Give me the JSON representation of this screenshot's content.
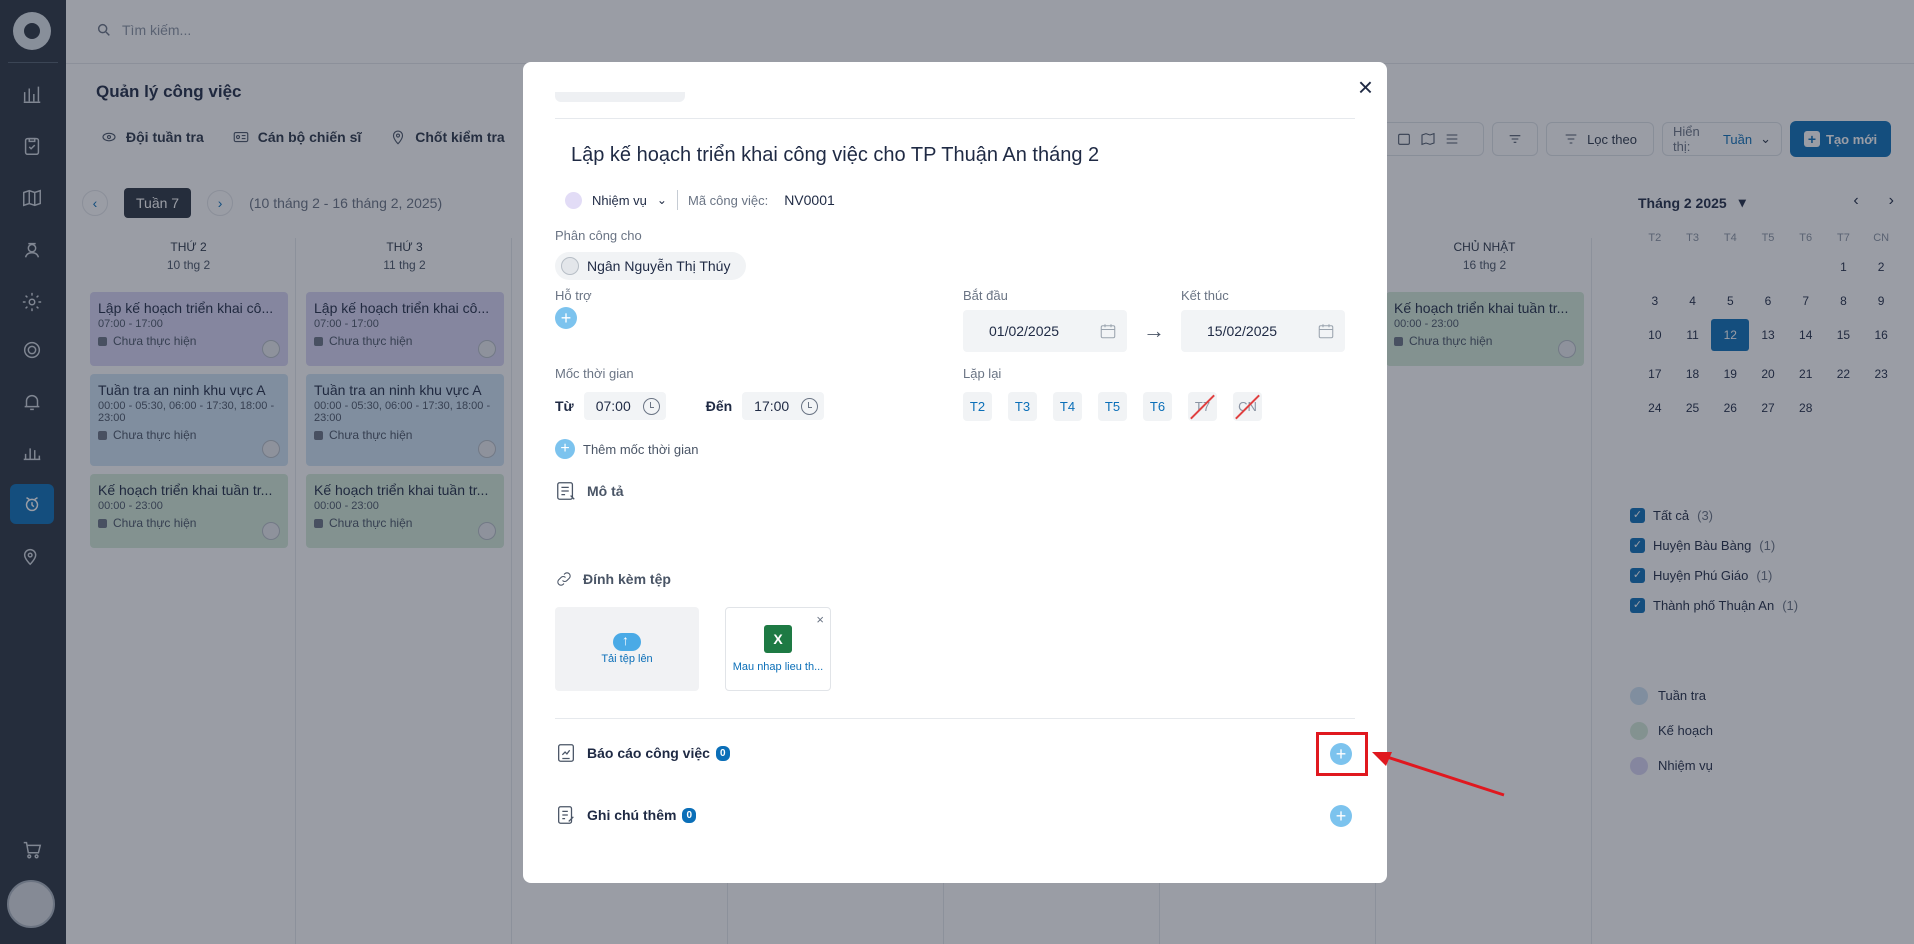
{
  "search": {
    "placeholder": "Tìm kiếm..."
  },
  "page": {
    "title": "Quản lý công việc"
  },
  "tabs": [
    {
      "label": "Đội tuần tra",
      "icon": "patrol-icon"
    },
    {
      "label": "Cán bộ chiến sĩ",
      "icon": "id-card-icon"
    },
    {
      "label": "Chốt kiểm tra",
      "icon": "location-pin-icon"
    }
  ],
  "toolbar": {
    "filter_label": "Lọc theo",
    "display_label": "Hiển thị:",
    "display_value": "Tuần",
    "new_label": "Tạo mới"
  },
  "week": {
    "label": "Tuần 7",
    "range": "(10 tháng 2 - 16 tháng 2, 2025)"
  },
  "columns": [
    {
      "day": "THỨ 2",
      "date": "10 thg 2"
    },
    {
      "day": "THỨ 3",
      "date": "11 thg 2"
    },
    {
      "day": "CHỦ NHẬT",
      "date": "16 thg 2"
    }
  ],
  "cards": {
    "c1": {
      "title": "Lập kế hoạch triển khai cô...",
      "time": "07:00 - 17:00",
      "status": "Chưa thực hiện"
    },
    "c2": {
      "title": "Tuần tra an ninh khu vực A",
      "time": "00:00 - 05:30, 06:00 - 17:30, 18:00 - 23:00",
      "status": "Chưa thực hiện"
    },
    "c3": {
      "title": "Kế hoạch triển khai tuần tr...",
      "time": "00:00 - 23:00",
      "status": "Chưa thực hiện"
    },
    "c4": {
      "title": "Lập kế hoạch triển khai cô...",
      "time": "07:00 - 17:00",
      "status": "Chưa thực hiện"
    },
    "c5": {
      "title": "Tuần tra an ninh khu vực A",
      "time": "00:00 - 05:30, 06:00 - 17:30, 18:00 - 23:00",
      "status": "Chưa thực hiện"
    },
    "c6": {
      "title": "Kế hoạch triển khai tuần tr...",
      "time": "00:00 - 23:00",
      "status": "Chưa thực hiện"
    },
    "c7": {
      "title": "Kế hoạch triển khai tuần tr...",
      "time": "00:00 - 23:00",
      "status": "Chưa thực hiện"
    }
  },
  "minical": {
    "title": "Tháng 2 2025",
    "dow": [
      "T2",
      "T3",
      "T4",
      "T5",
      "T6",
      "T7",
      "CN"
    ],
    "days": [
      "",
      "",
      "",
      "",
      "",
      "1",
      "2",
      "3",
      "4",
      "5",
      "6",
      "7",
      "8",
      "9",
      "10",
      "11",
      "12",
      "13",
      "14",
      "15",
      "16",
      "17",
      "18",
      "19",
      "20",
      "21",
      "22",
      "23",
      "24",
      "25",
      "26",
      "27",
      "28",
      "",
      ""
    ],
    "today": "12"
  },
  "filters": [
    {
      "label": "Tất cả",
      "count": "(3)"
    },
    {
      "label": "Huyện Bàu Bàng",
      "count": "(1)"
    },
    {
      "label": "Huyện Phú Giáo",
      "count": "(1)"
    },
    {
      "label": "Thành phố Thuận An",
      "count": "(1)"
    }
  ],
  "legend": [
    {
      "label": "Tuần tra",
      "color": "#cfe4f4"
    },
    {
      "label": "Kế hoạch",
      "color": "#d5ecd9"
    },
    {
      "label": "Nhiệm vụ",
      "color": "#d9d6f4"
    }
  ],
  "modal": {
    "title": "Lập kế hoạch triển khai công việc cho TP Thuận An tháng 2",
    "type_label": "Nhiệm vụ",
    "code_label": "Mã công việc:",
    "code_value": "NV0001",
    "assign_label": "Phân công cho",
    "assignee": "Ngân Nguyễn Thị Thúy",
    "support_label": "Hỗ trợ",
    "start_label": "Bắt đầu",
    "start_value": "01/02/2025",
    "end_label": "Kết thúc",
    "end_value": "15/02/2025",
    "milestone_label": "Mốc thời gian",
    "from_label": "Từ",
    "from_value": "07:00",
    "to_label": "Đến",
    "to_value": "17:00",
    "repeat_label": "Lặp lại",
    "repeat_days": [
      "T2",
      "T3",
      "T4",
      "T5",
      "T6",
      "T7",
      "CN"
    ],
    "add_time_label": "Thêm mốc thời gian",
    "desc_label": "Mô tả",
    "attach_label": "Đính kèm tệp",
    "upload_label": "Tải tệp lên",
    "file_name": "Mau nhap lieu th...",
    "report_label": "Báo cáo công việc",
    "report_count": "0",
    "note_label": "Ghi chú thêm",
    "note_count": "0"
  }
}
